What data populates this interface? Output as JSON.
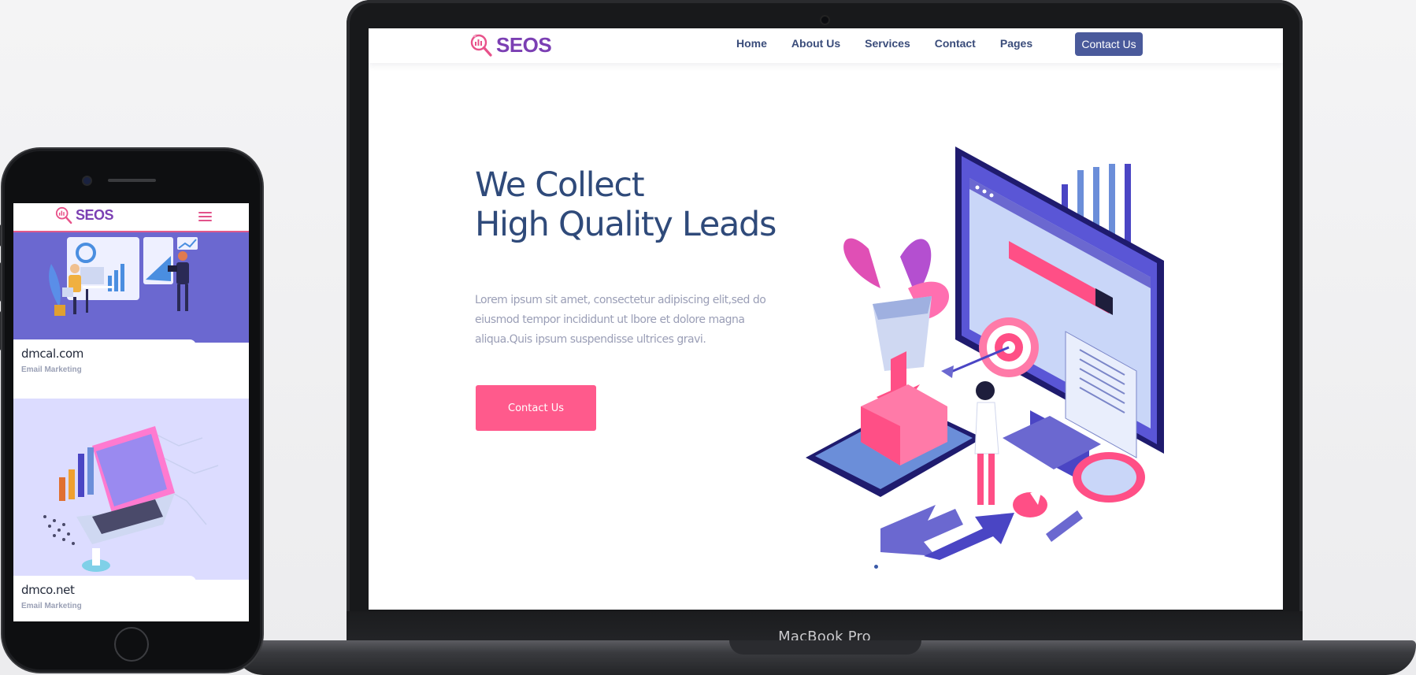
{
  "laptop": {
    "brand_label": "MacBook Pro",
    "site": {
      "logo_text": "SEOS",
      "nav": [
        "Home",
        "About Us",
        "Services",
        "Contact",
        "Pages"
      ],
      "nav_cta_label": "Contact Us",
      "hero": {
        "title_line1": "We Collect",
        "title_line2": "High Quality Leads",
        "description": "Lorem ipsum sit amet, consectetur adipiscing elit,sed do eiusmod tempor incididunt ut lbore et dolore magna aliqua.Quis ipsum suspendisse ultrices gravi.",
        "cta_label": "Contact Us"
      }
    }
  },
  "phone": {
    "logo_text": "SEOS",
    "cards": [
      {
        "title": "dmcal.com",
        "subtitle": "Email Marketing"
      },
      {
        "title": "dmco.net",
        "subtitle": "Email Marketing"
      }
    ]
  },
  "colors": {
    "brand_purple": "#7b3fb3",
    "nav_text": "#3a4c7a",
    "nav_cta_bg": "#4a5a9b",
    "hero_title": "#2f4a7a",
    "hero_cta_bg": "#ff5a8c",
    "card1_bg": "#6b68d0",
    "card2_bg": "#dcdcff"
  },
  "icons": [
    "seos-logo-icon",
    "hamburger-menu-icon",
    "seo-isometric-illustration",
    "analytics-team-illustration",
    "laptop-analytics-illustration"
  ]
}
